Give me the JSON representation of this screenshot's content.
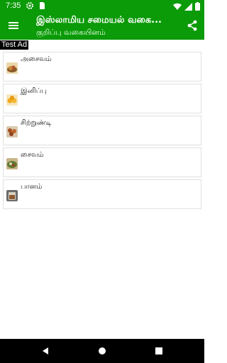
{
  "status_bar": {
    "time": "7:35",
    "icons": [
      "settings-gear-icon",
      "sim-card-icon",
      "wifi-icon",
      "signal-icon",
      "battery-icon"
    ]
  },
  "app_bar": {
    "title": "இஸ்லாமிய சமையல் வகை...",
    "subtitle": "குறிப்பு வகையினம்",
    "color": "#0b9a08"
  },
  "ad_label": "Test Ad",
  "categories": [
    {
      "label": "அசைவம்",
      "icon": "meat-dish-icon"
    },
    {
      "label": "இனிப்பு",
      "icon": "sweets-icon"
    },
    {
      "label": "சிற்றுண்டி",
      "icon": "snack-icon"
    },
    {
      "label": "சைவம்",
      "icon": "veg-dish-icon"
    },
    {
      "label": "பானம்",
      "icon": "drink-icon"
    }
  ]
}
